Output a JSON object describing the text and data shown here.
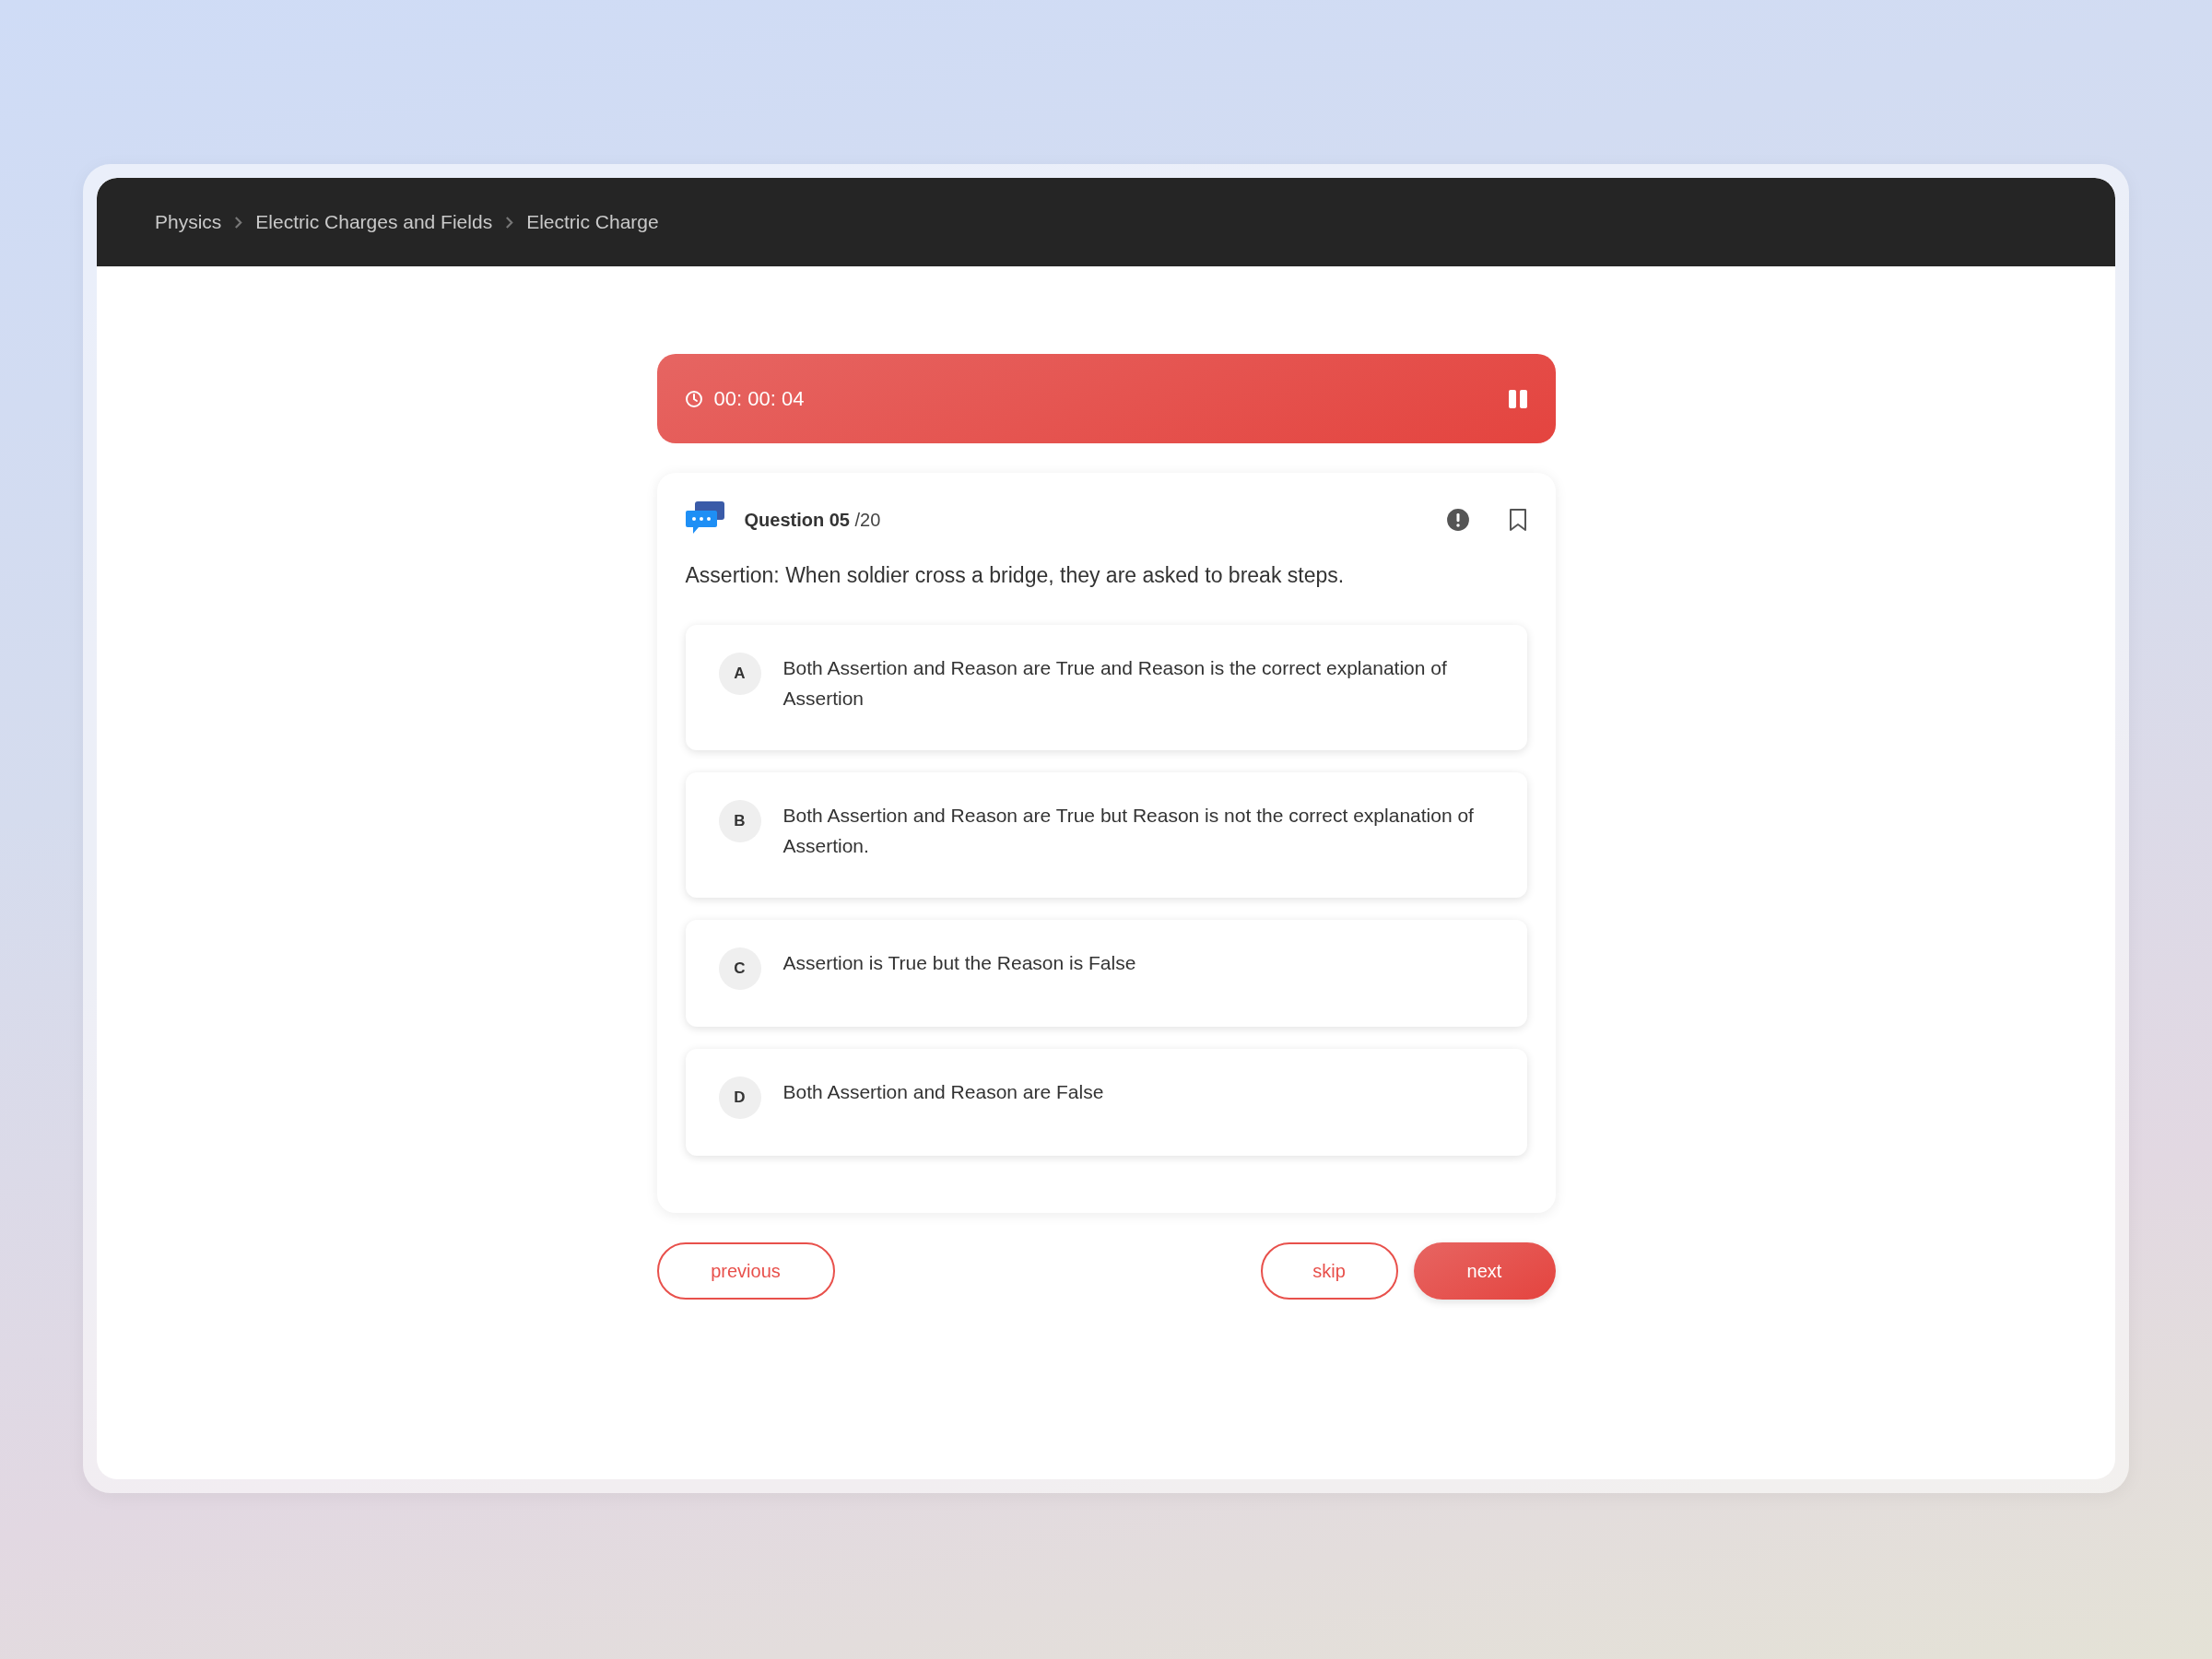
{
  "breadcrumb": [
    "Physics",
    "Electric Charges and Fields",
    "Electric Charge"
  ],
  "timer": {
    "time": "00: 00: 04"
  },
  "question": {
    "label": "Question 05",
    "total": "/20",
    "text": "Assertion: When soldier cross a bridge, they are asked to break steps."
  },
  "options": [
    {
      "letter": "A",
      "text": "Both Assertion and Reason are True and Reason is the correct explanation of Assertion"
    },
    {
      "letter": "B",
      "text": "Both Assertion and Reason are True but Reason is not the correct explanation of Assertion."
    },
    {
      "letter": "C",
      "text": "Assertion is True but the Reason is False"
    },
    {
      "letter": "D",
      "text": "Both Assertion and Reason are False"
    }
  ],
  "buttons": [
    {
      "label": "previous",
      "kind": "outline"
    },
    {
      "label": "skip",
      "kind": "outline"
    },
    {
      "label": "next",
      "kind": "filled"
    }
  ]
}
